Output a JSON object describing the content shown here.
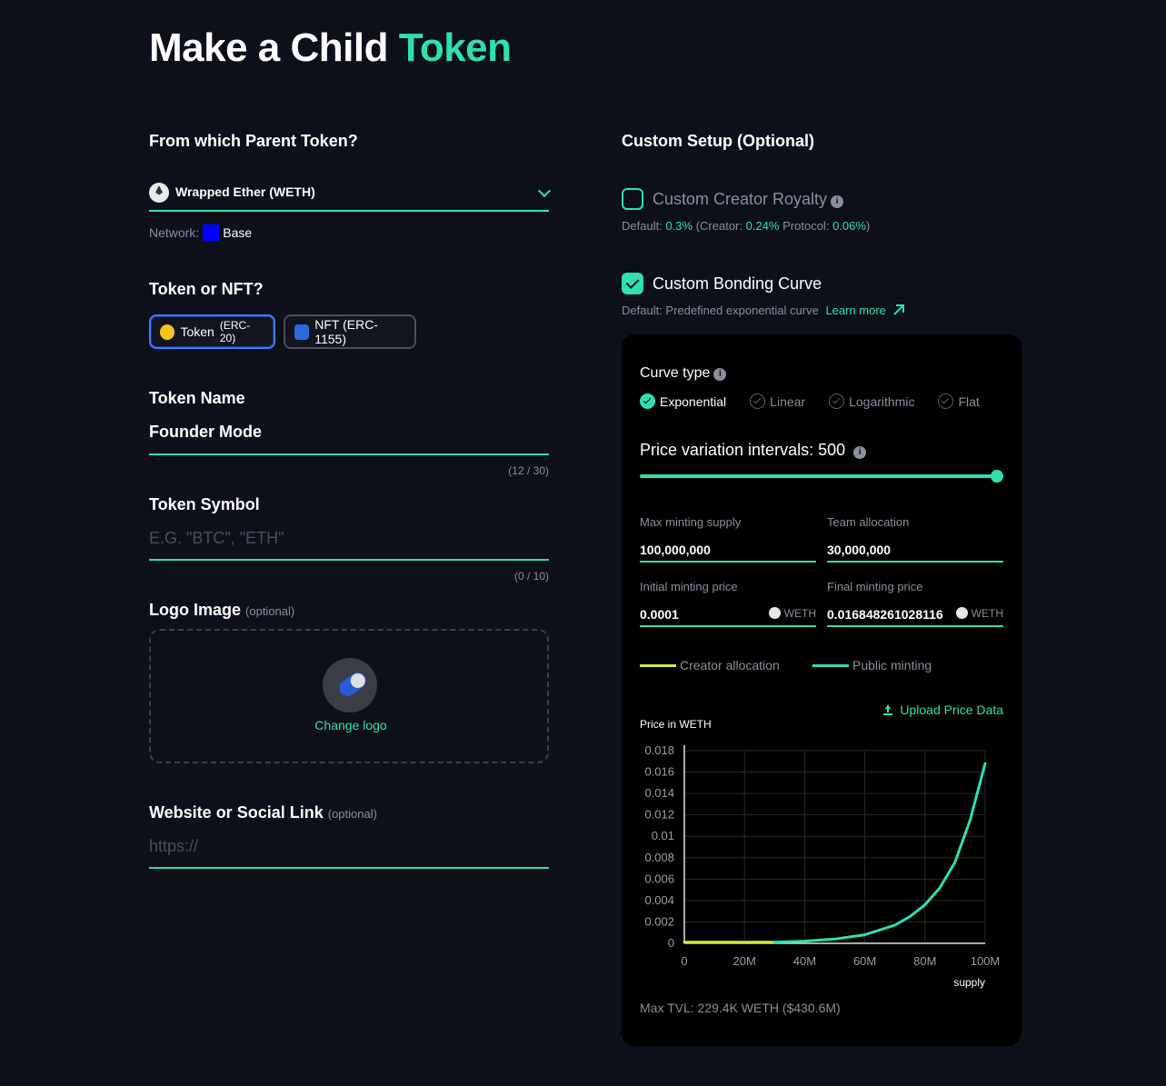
{
  "title": {
    "part1": "Make a Child",
    "part2": "Token"
  },
  "parent": {
    "label": "From which Parent Token?",
    "selected": "Wrapped Ether (WETH)",
    "network_label": "Network:",
    "network_value": "Base"
  },
  "token_type": {
    "label": "Token or NFT?",
    "options": [
      {
        "label": "Token",
        "sub": "(ERC-20)",
        "color": "#f5c518",
        "active": true
      },
      {
        "label": "NFT (ERC-1155)",
        "sub": "",
        "color": "#2a6ae0",
        "active": false
      }
    ]
  },
  "token_name": {
    "label": "Token Name",
    "value": "Founder Mode",
    "counter": "(12 / 30)"
  },
  "token_symbol": {
    "label": "Token Symbol",
    "placeholder": "E.G. \"BTC\", \"ETH\"",
    "counter": "(0 / 10)"
  },
  "logo": {
    "label": "Logo Image",
    "optional": "(optional)",
    "change": "Change logo"
  },
  "website": {
    "label": "Website or Social Link",
    "optional": "(optional)",
    "placeholder": "https://"
  },
  "custom_setup": {
    "label": "Custom Setup (Optional)",
    "royalty": {
      "label": "Custom Creator Royalty",
      "checked": false,
      "default_prefix": "Default:",
      "default_value": "0.3%",
      "creator_prefix": "(Creator:",
      "creator_value": "0.24%",
      "protocol_prefix": "Protocol:",
      "protocol_value": "0.06%",
      "suffix": ")"
    },
    "bonding": {
      "label": "Custom Bonding Curve",
      "checked": true,
      "default_text": "Default: Predefined exponential curve",
      "learn_more": "Learn more"
    }
  },
  "curve": {
    "type_label": "Curve type",
    "types": [
      {
        "label": "Exponential",
        "selected": true
      },
      {
        "label": "Linear",
        "selected": false
      },
      {
        "label": "Logarithmic",
        "selected": false
      },
      {
        "label": "Flat",
        "selected": false
      }
    ],
    "intervals_label": "Price variation intervals:",
    "intervals_value": "500",
    "slider_fraction": 1.0,
    "fields": {
      "max_supply": {
        "label": "Max minting supply",
        "value": "100,000,000"
      },
      "team_alloc": {
        "label": "Team allocation",
        "value": "30,000,000"
      },
      "init_price": {
        "label": "Initial minting price",
        "value": "0.0001",
        "unit": "WETH"
      },
      "final_price": {
        "label": "Final minting price",
        "value": "0.016848261028116",
        "unit": "WETH"
      }
    },
    "legend": [
      {
        "label": "Creator allocation",
        "color": "#d4e84a"
      },
      {
        "label": "Public minting",
        "color": "#2ee0b0"
      }
    ],
    "upload": "Upload Price Data",
    "max_tvl": "Max TVL: 229.4K WETH ($430.6M)"
  },
  "chart_data": {
    "type": "line",
    "ylabel": "Price in WETH",
    "xlabel": "supply",
    "xlim": [
      0,
      100000000
    ],
    "ylim": [
      0,
      0.018
    ],
    "x_ticks": [
      "0",
      "20M",
      "40M",
      "60M",
      "80M",
      "100M"
    ],
    "y_ticks": [
      "0",
      "0.002",
      "0.004",
      "0.006",
      "0.008",
      "0.01",
      "0.012",
      "0.014",
      "0.016",
      "0.018"
    ],
    "grid": true,
    "series": [
      {
        "name": "Creator allocation",
        "color": "#d4e84a",
        "x": [
          0,
          30000000
        ],
        "y": [
          0.0001,
          0.0001
        ]
      },
      {
        "name": "Public minting",
        "color": "#2ee0b0",
        "x": [
          30000000,
          40000000,
          50000000,
          60000000,
          70000000,
          75000000,
          80000000,
          85000000,
          90000000,
          95000000,
          100000000
        ],
        "y": [
          0.0001,
          0.0002,
          0.0004,
          0.0008,
          0.0017,
          0.0025,
          0.0036,
          0.0052,
          0.0076,
          0.0115,
          0.0168
        ]
      }
    ]
  }
}
